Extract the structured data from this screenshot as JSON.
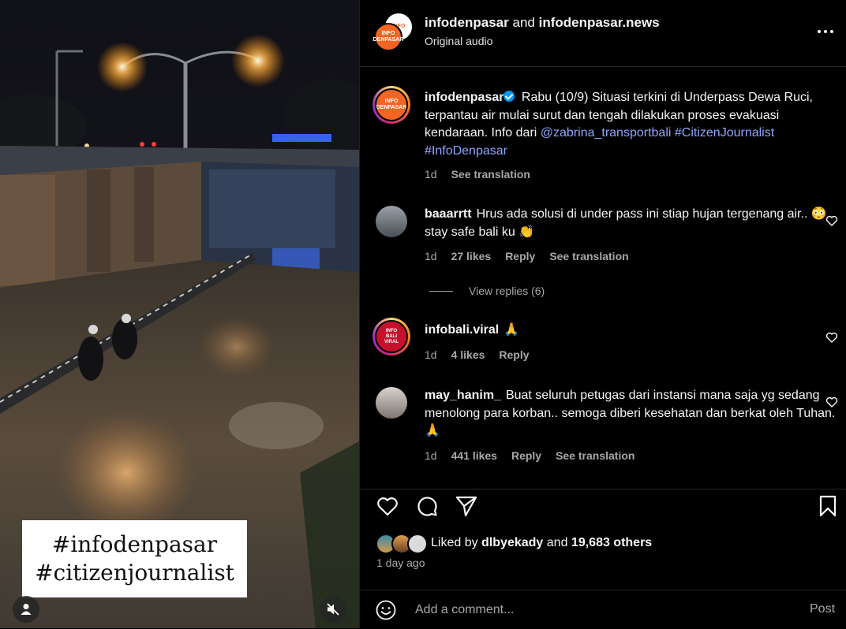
{
  "media": {
    "overlay_line1": "#infodenpasar",
    "overlay_line2": "#citizenjournalist"
  },
  "header": {
    "author1": "infodenpasar",
    "conj": "and",
    "author2": "infodenpasar.news",
    "audio": "Original audio",
    "logo_text1": "INFO",
    "logo_text2": "DENPASAR"
  },
  "caption": {
    "user": "infodenpasar",
    "text": "Rabu (10/9) Situasi terkini di Underpass Dewa Ruci, terpantau air mulai surut dan tengah dilakukan proses evakuasi kendaraan. Info dari ",
    "mention": "@zabrina_transportbali",
    "hashtag1": "#CitizenJournalist",
    "hashtag2": "#InfoDenpasar",
    "time": "1d",
    "translate": "See translation"
  },
  "comments": [
    {
      "user": "baaarrtt",
      "text": "Hrus ada solusi di under pass ini stiap hujan tergenang air.. 😳 stay safe bali ku 👏",
      "time": "1d",
      "likes": "27 likes",
      "reply": "Reply",
      "translate": "See translation",
      "view_replies": "View replies (6)"
    },
    {
      "user": "infobali.viral",
      "text": "🙏",
      "time": "1d",
      "likes": "4 likes",
      "reply": "Reply",
      "logo1": "INFO",
      "logo2": "BALI",
      "logo3": "VIRAL"
    },
    {
      "user": "may_hanim_",
      "text": "Buat seluruh petugas dari instansi mana saja yg sedang menolong para korban.. semoga diberi kesehatan dan berkat oleh Tuhan. 🙏",
      "time": "1d",
      "likes": "441 likes",
      "reply": "Reply",
      "translate": "See translation"
    }
  ],
  "likes": {
    "prefix": "Liked by",
    "user": "dlbyekady",
    "conj": "and",
    "others": "19,683 others"
  },
  "date": "1 day ago",
  "composer": {
    "placeholder": "Add a comment...",
    "post": "Post"
  },
  "colors": {
    "background": "#000000",
    "brand_orange": "#f26522",
    "link": "#8ea6ff",
    "muted": "#a8a8a8",
    "verified": "#0095f6"
  }
}
